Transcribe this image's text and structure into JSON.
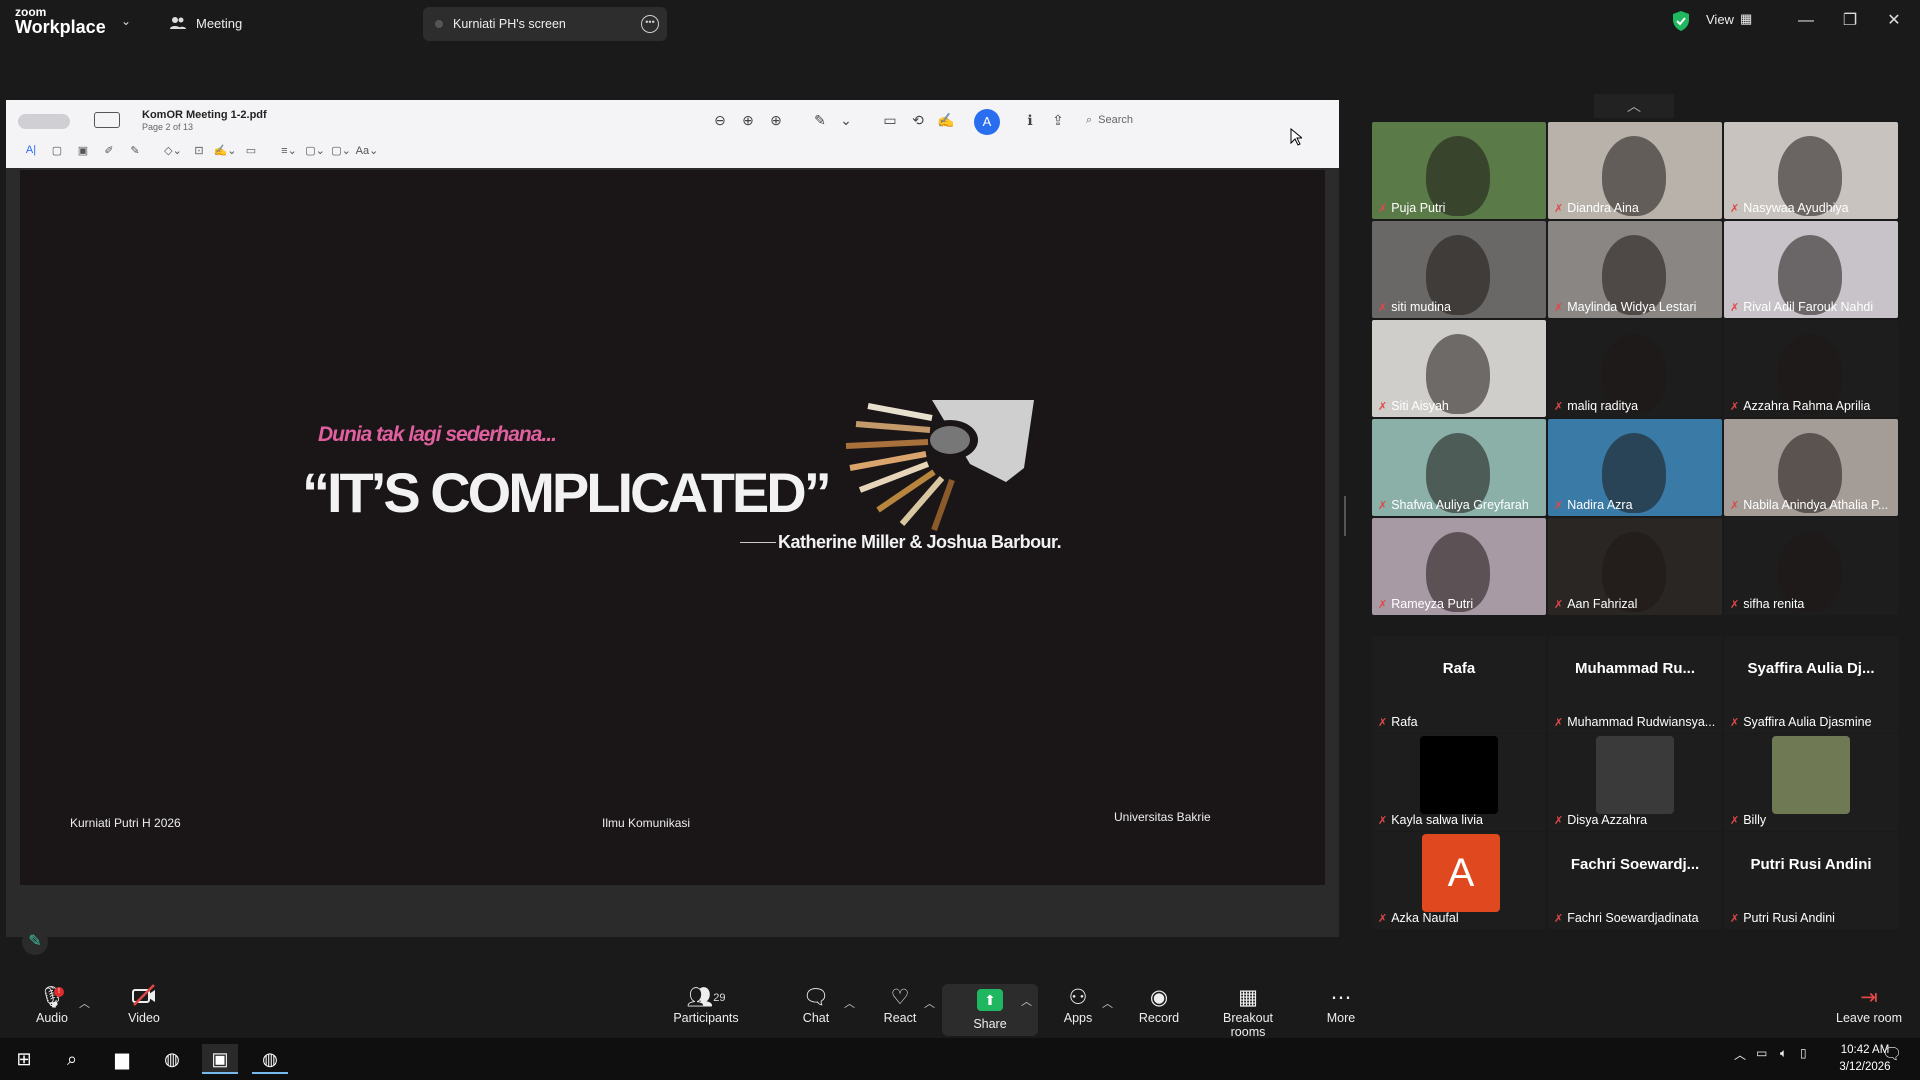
{
  "topbar": {
    "logo_small": "zoom",
    "logo_big": "Workplace",
    "meeting_label": "Meeting",
    "screen_tab_label": "Kurniati PH's screen",
    "view_label": "View",
    "minimize": "—",
    "restore": "❐",
    "close": "✕"
  },
  "pdf": {
    "doc_title": "KomOR Meeting 1-2.pdf",
    "doc_subtitle": "Page 2 of 13",
    "search_placeholder": "Search",
    "toolbar_icons": [
      "zoom-out-icon",
      "zoom-in-icon",
      "zoom-fit-icon",
      "highlight-pen-icon",
      "crop-icon",
      "rotate-icon",
      "sign-icon",
      "markup-icon",
      "info-icon",
      "share-icon"
    ]
  },
  "slide": {
    "pre_heading": "Dunia tak lagi sederhana...",
    "quote": "“IT’S COMPLICATED”",
    "author": "Katherine Miller & Joshua Barbour.",
    "footer_left": "Kurniati Putri H 2026",
    "footer_center": "Ilmu Komunikasi",
    "footer_right": "Universitas Bakrie"
  },
  "gallery": {
    "video_tiles": [
      {
        "name": "Puja Putri",
        "bg": "#5a7a48"
      },
      {
        "name": "Diandra Aina",
        "bg": "#b8b2aa"
      },
      {
        "name": "Nasywaa Ayudhiya",
        "bg": "#c8c3be"
      },
      {
        "name": "siti mudina",
        "bg": "#6a6866"
      },
      {
        "name": "Maylinda Widya Lestari",
        "bg": "#8a8684"
      },
      {
        "name": "Rival Adil Farouk Nahdi",
        "bg": "#c7c3c8"
      },
      {
        "name": "Siti Aisyah",
        "bg": "#d0cecb"
      },
      {
        "name": "maliq raditya",
        "bg": "#1d1d1d"
      },
      {
        "name": "Azzahra Rahma Aprilia",
        "bg": "#1d1d1d"
      },
      {
        "name": "Shafwa Auliya Greyfarah",
        "bg": "#8ab0a8"
      },
      {
        "name": "Nadira Azra",
        "bg": "#3a7aa6"
      },
      {
        "name": "Nabila Anindya Athalia P...",
        "bg": "#a49c96"
      },
      {
        "name": "Rameyza Putri",
        "bg": "#a89aa4"
      },
      {
        "name": "Aan Fahrizal",
        "bg": "#2a2624"
      },
      {
        "name": "sifha renita",
        "bg": "#1d1d1d"
      }
    ],
    "name_tiles": [
      {
        "big": "Rafa",
        "name": "Rafa"
      },
      {
        "big": "Muhammad Ru...",
        "name": "Muhammad Rudwiansya..."
      },
      {
        "big": "Syaffira Aulia Dj...",
        "name": "Syaffira Aulia Djasmine"
      },
      {
        "big": "",
        "name": "Kayla salwa livia"
      },
      {
        "big": "",
        "name": "Disya Azzahra"
      },
      {
        "big": "",
        "name": "Billy"
      },
      {
        "big": "",
        "name": "Azka Naufal",
        "avatar": "A"
      },
      {
        "big": "Fachri  Soewardj...",
        "name": "Fachri Soewardjadinata"
      },
      {
        "big": "Putri Rusi Andini",
        "name": "Putri Rusi Andini"
      }
    ]
  },
  "toolbar": {
    "audio": "Audio",
    "video": "Video",
    "participants": "Participants",
    "participants_count": "29",
    "chat": "Chat",
    "react": "React",
    "share": "Share",
    "apps": "Apps",
    "record": "Record",
    "breakout": "Breakout rooms",
    "more": "More",
    "leave": "Leave room"
  },
  "taskbar": {
    "time": "10:42 AM",
    "date": "3/12/2026",
    "notification_count": "1"
  },
  "colors": {
    "accent_green": "#1fb860",
    "mic_off_red": "#e04848",
    "slide_pink": "#e0609f",
    "markup_blue": "#2a6ef0"
  }
}
